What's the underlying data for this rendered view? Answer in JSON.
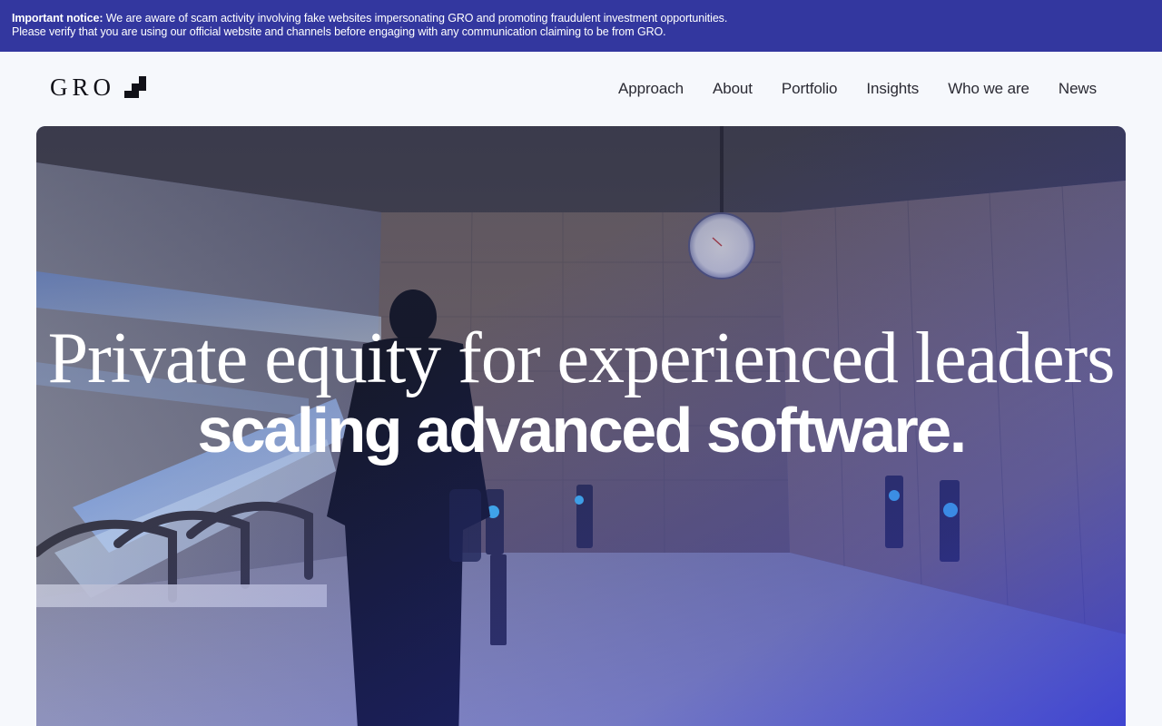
{
  "notice": {
    "label": "Important notice:",
    "line1": "We are aware of scam activity involving fake websites impersonating GRO and promoting fraudulent investment opportunities.",
    "line2": "Please verify that you are using our official website and channels before engaging with any communication claiming to be from GRO."
  },
  "brand": {
    "name": "GRO",
    "icon": "checker-steps-icon"
  },
  "nav": {
    "items": [
      {
        "label": "Approach"
      },
      {
        "label": "About"
      },
      {
        "label": "Portfolio"
      },
      {
        "label": "Insights"
      },
      {
        "label": "Who we are"
      },
      {
        "label": "News"
      }
    ]
  },
  "hero": {
    "title_line1": "Private equity for experienced leaders",
    "title_line2": "scaling advanced software."
  },
  "colors": {
    "notice_bg": "#33379f",
    "page_bg": "#f6f8fc",
    "hero_accent": "#2b31d6"
  }
}
